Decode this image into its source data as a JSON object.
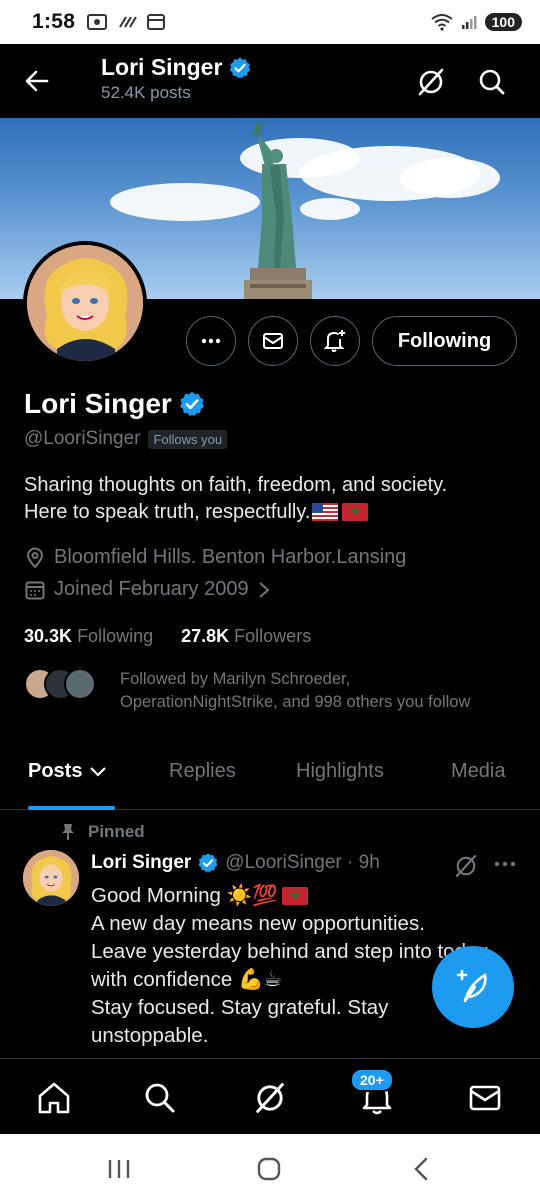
{
  "status_bar": {
    "time": "1:58",
    "battery": "100"
  },
  "header": {
    "name": "Lori Singer",
    "posts_count": "52.4K posts"
  },
  "profile": {
    "name": "Lori Singer",
    "handle": "@LooriSinger",
    "follows_you": "Follows you",
    "bio_line1": "Sharing thoughts on faith, freedom, and society.",
    "bio_line2": "Here to speak truth, respectfully.",
    "location": "Bloomfield Hills. Benton Harbor.Lansing",
    "joined": "Joined February 2009",
    "following_count": "30.3K",
    "following_label": "Following",
    "followers_count": "27.8K",
    "followers_label": "Followers",
    "followed_by_line1": "Followed by Marilyn Schroeder,",
    "followed_by_line2": "OperationNightStrike, and 998 others you follow"
  },
  "actions": {
    "following_button": "Following"
  },
  "tabs": [
    {
      "label": "Posts"
    },
    {
      "label": "Replies"
    },
    {
      "label": "Highlights"
    },
    {
      "label": "Media"
    }
  ],
  "post": {
    "pinned_label": "Pinned",
    "name": "Lori Singer",
    "handle_time": "@LooriSinger · 9h",
    "line1": "Good Morning ☀️💯",
    "line2": "A new day means new opportunities.",
    "line3": "Leave yesterday behind and step into today",
    "line4": "with confidence 💪☕",
    "line5": "Stay focused. Stay grateful. Stay",
    "line6": "unstoppable."
  },
  "bottom_nav": {
    "notifications_badge": "20+"
  },
  "colors": {
    "accent": "#1d9bf0",
    "background": "#000000",
    "muted_text": "#71767b"
  }
}
